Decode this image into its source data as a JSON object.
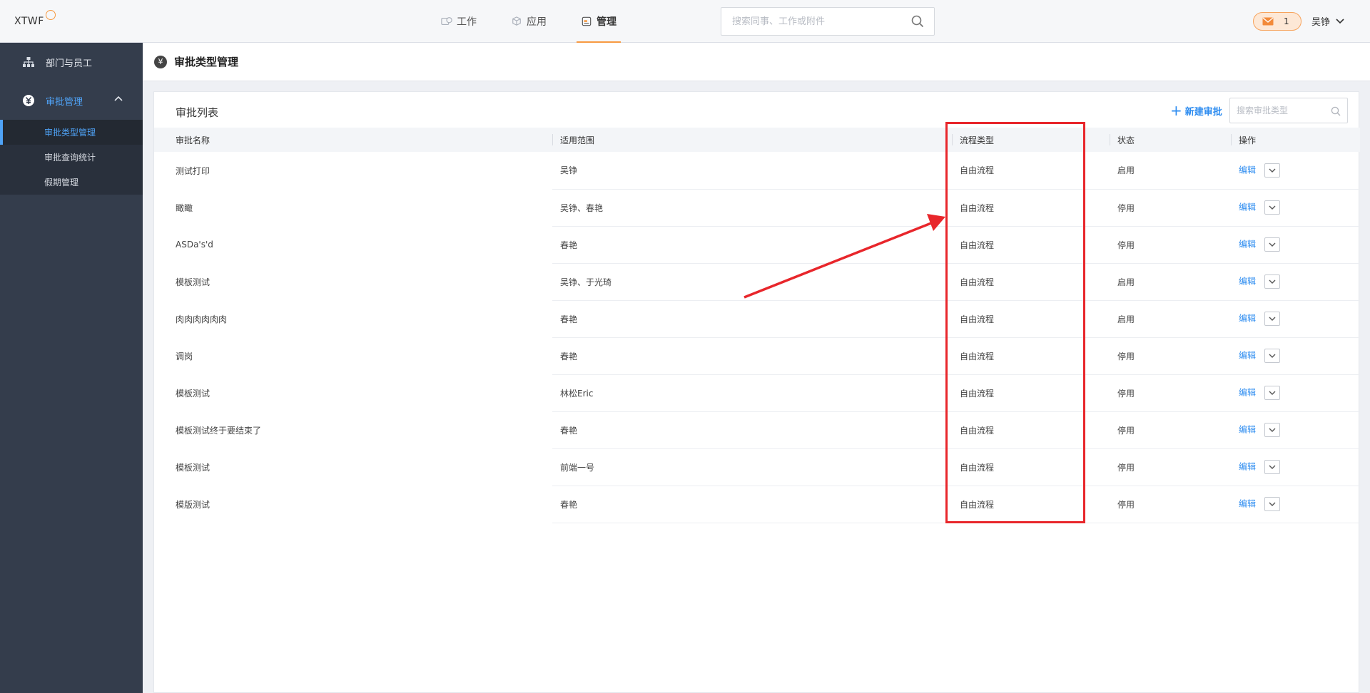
{
  "app": {
    "logo_text": "XTWF"
  },
  "nav": {
    "items": [
      {
        "label": "工作",
        "icon": "work-icon",
        "active": false
      },
      {
        "label": "应用",
        "icon": "apps-cube-icon",
        "active": false
      },
      {
        "label": "管理",
        "icon": "manage-icon",
        "active": true
      }
    ]
  },
  "top_search": {
    "placeholder": "搜索同事、工作或附件",
    "value": ""
  },
  "messages": {
    "count": "1"
  },
  "user": {
    "name": "吴铮"
  },
  "sidebar": {
    "items": [
      {
        "label": "部门与员工",
        "icon": "org-chart-icon"
      },
      {
        "label": "审批管理",
        "icon": "yen-circle-icon",
        "expanded": true
      }
    ],
    "sub_items": [
      {
        "label": "审批类型管理",
        "active": true
      },
      {
        "label": "审批查询统计",
        "active": false
      },
      {
        "label": "假期管理",
        "active": false
      }
    ]
  },
  "page": {
    "title": "审批类型管理"
  },
  "card": {
    "title": "审批列表",
    "new_button_label": "新建审批",
    "search_placeholder": "搜索审批类型"
  },
  "table": {
    "columns": [
      "审批名称",
      "适用范围",
      "流程类型",
      "状态",
      "操作"
    ],
    "edit_label": "编辑",
    "rows": [
      {
        "name": "测试打印",
        "scope": "吴铮",
        "flow": "自由流程",
        "status": "启用"
      },
      {
        "name": "瞰瞰",
        "scope": "吴铮、春艳",
        "flow": "自由流程",
        "status": "停用"
      },
      {
        "name": "ASDa's'd",
        "scope": "春艳",
        "flow": "自由流程",
        "status": "停用"
      },
      {
        "name": "模板测试",
        "scope": "吴铮、于光琦",
        "flow": "自由流程",
        "status": "启用"
      },
      {
        "name": "肉肉肉肉肉肉",
        "scope": "春艳",
        "flow": "自由流程",
        "status": "启用"
      },
      {
        "name": "调岗",
        "scope": "春艳",
        "flow": "自由流程",
        "status": "停用"
      },
      {
        "name": "模板测试",
        "scope": "林松Eric",
        "flow": "自由流程",
        "status": "停用"
      },
      {
        "name": "模板测试终于要结束了",
        "scope": "春艳",
        "flow": "自由流程",
        "status": "停用"
      },
      {
        "name": "模板测试",
        "scope": "前端一号",
        "flow": "自由流程",
        "status": "停用"
      },
      {
        "name": "模版测试",
        "scope": "春艳",
        "flow": "自由流程",
        "status": "停用"
      }
    ]
  },
  "colors": {
    "accent_orange": "#f79a41",
    "link_blue": "#2d8cf0",
    "sidebar_bg": "#343d4c",
    "annotation_red": "#e8262b"
  }
}
